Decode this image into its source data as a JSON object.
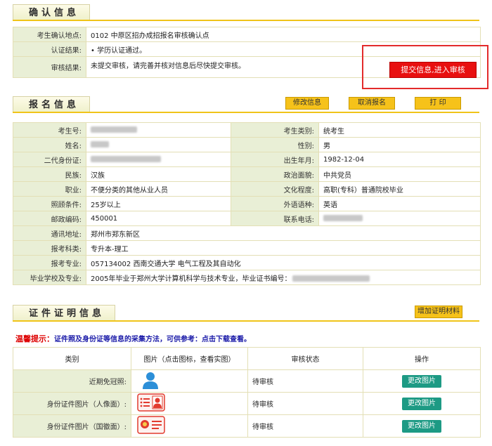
{
  "confirm_section": {
    "title": "确认信息",
    "rows": [
      {
        "label": "考生确认地点:",
        "value": "0102   中原区招办成招报名审核确认点"
      },
      {
        "label": "认证结果:",
        "value": "• 学历认证通过。"
      },
      {
        "label": "审核结果:",
        "value": "未提交审核，请完善并核对信息后尽快提交审核。"
      }
    ],
    "submit_button": "提交信息,进入审核"
  },
  "signup_section": {
    "title": "报名信息",
    "buttons": {
      "edit": "修改信息",
      "cancel": "取消报名",
      "print": "打    印"
    },
    "rows": [
      {
        "l1": "考生号:",
        "v1": "",
        "l2": "考生类别:",
        "v2": "统考生"
      },
      {
        "l1": "姓名:",
        "v1": "",
        "l2": "性别:",
        "v2": "男"
      },
      {
        "l1": "二代身份证:",
        "v1": "",
        "l2": "出生年月:",
        "v2": "1982-12-04"
      },
      {
        "l1": "民族:",
        "v1": "汉族",
        "l2": "政治面貌:",
        "v2": "中共党员"
      },
      {
        "l1": "职业:",
        "v1": "不便分类的其他从业人员",
        "l2": "文化程度:",
        "v2": "高职(专科）普通院校毕业"
      },
      {
        "l1": "照顾条件:",
        "v1": "25岁以上",
        "l2": "外语语种:",
        "v2": "英语"
      },
      {
        "l1": "邮政编码:",
        "v1": "450001",
        "l2": "联系电话:",
        "v2": ""
      }
    ],
    "wide_rows": [
      {
        "label": "通讯地址:",
        "value": "郑州市郑东新区"
      },
      {
        "label": "报考科类:",
        "value": "专升本-理工"
      },
      {
        "label": "报考专业:",
        "value": "057134002  西南交通大学  电气工程及其自动化"
      },
      {
        "label": "毕业学校及专业:",
        "value": "2005年毕业于郑州大学计算机科学与技术专业，毕业证书编号："
      }
    ]
  },
  "cert_section": {
    "title": "证件证明信息",
    "add_button": "增加证明材料",
    "tip_prefix": "温馨提示：",
    "tip_text": "证件照及身份证等信息的采集方法，可供参考：点击下载查看。",
    "headers": [
      "类别",
      "图片（点击图标，查看实图）",
      "审核状态",
      "操作"
    ],
    "rows": [
      {
        "category": "近期免冠照:",
        "icon": "person-icon",
        "status": "待审核",
        "action": "更改图片"
      },
      {
        "category": "身份证件图片（人像面）:",
        "icon": "id-card-front-icon",
        "status": "待审核",
        "action": "更改图片"
      },
      {
        "category": "身份证件图片（国徽面）:",
        "icon": "id-card-back-icon",
        "status": "待审核",
        "action": "更改图片"
      }
    ]
  },
  "colors": {
    "accent": "#f6c21a",
    "label_bg": "#e9efd6",
    "submit": "#e81010",
    "action": "#1d9a84"
  }
}
